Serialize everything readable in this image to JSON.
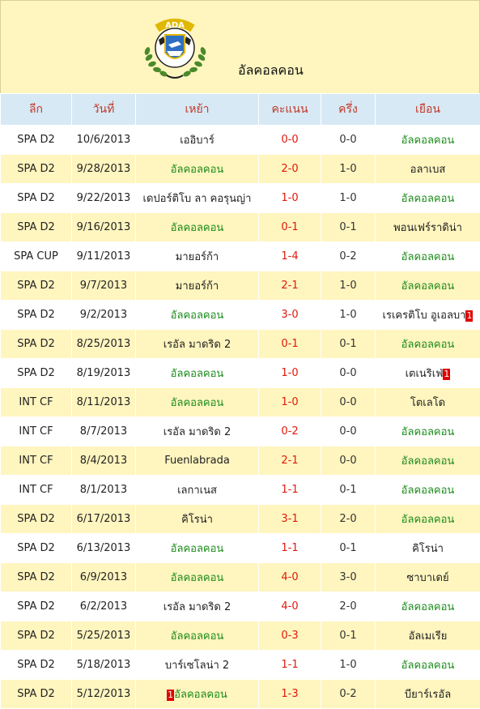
{
  "header": {
    "team_name": "อัลคอลคอน",
    "logo_text": "ADA"
  },
  "columns": {
    "league": "ลีก",
    "date": "วันที่",
    "home": "เหย้า",
    "score": "คะแนน",
    "half": "ครึ่ง",
    "away": "เยือน"
  },
  "rows": [
    {
      "league": "SPA D2",
      "date": "10/6/2013",
      "home": "เออิบาร์",
      "score": "0-0",
      "half": "0-0",
      "away": "อัลคอลคอน",
      "hl": "away"
    },
    {
      "league": "SPA D2",
      "date": "9/28/2013",
      "home": "อัลคอลคอน",
      "score": "2-0",
      "half": "1-0",
      "away": "อลาเบส",
      "hl": "home"
    },
    {
      "league": "SPA D2",
      "date": "9/22/2013",
      "home": "เดปอร์ติโบ ลา คอรุนญ่า",
      "score": "1-0",
      "half": "1-0",
      "away": "อัลคอลคอน",
      "hl": "away"
    },
    {
      "league": "SPA D2",
      "date": "9/16/2013",
      "home": "อัลคอลคอน",
      "score": "0-1",
      "half": "0-1",
      "away": "พอนเฟร์ราดิน่า",
      "hl": "home"
    },
    {
      "league": "SPA CUP",
      "date": "9/11/2013",
      "home": "มายอร์ก้า",
      "score": "1-4",
      "half": "0-2",
      "away": "อัลคอลคอน",
      "hl": "away"
    },
    {
      "league": "SPA D2",
      "date": "9/7/2013",
      "home": "มายอร์ก้า",
      "score": "2-1",
      "half": "1-0",
      "away": "อัลคอลคอน",
      "hl": "away"
    },
    {
      "league": "SPA D2",
      "date": "9/2/2013",
      "home": "อัลคอลคอน",
      "score": "3-0",
      "half": "1-0",
      "away": "เรเครติโบ อูเอลบา",
      "away_card": "1",
      "hl": "home"
    },
    {
      "league": "SPA D2",
      "date": "8/25/2013",
      "home": "เรอัล มาดริด 2",
      "score": "0-1",
      "half": "0-1",
      "away": "อัลคอลคอน",
      "hl": "away"
    },
    {
      "league": "SPA D2",
      "date": "8/19/2013",
      "home": "อัลคอลคอน",
      "score": "1-0",
      "half": "0-0",
      "away": "เตเนริเฟ่",
      "away_card": "1",
      "hl": "home"
    },
    {
      "league": "INT CF",
      "date": "8/11/2013",
      "home": "อัลคอลคอน",
      "score": "1-0",
      "half": "0-0",
      "away": "โตเลโด",
      "hl": "home"
    },
    {
      "league": "INT CF",
      "date": "8/7/2013",
      "home": "เรอัล มาดริด 2",
      "score": "0-2",
      "half": "0-0",
      "away": "อัลคอลคอน",
      "hl": "away"
    },
    {
      "league": "INT CF",
      "date": "8/4/2013",
      "home": "Fuenlabrada",
      "score": "2-1",
      "half": "0-0",
      "away": "อัลคอลคอน",
      "hl": "away"
    },
    {
      "league": "INT CF",
      "date": "8/1/2013",
      "home": "เลกาเนส",
      "score": "1-1",
      "half": "0-1",
      "away": "อัลคอลคอน",
      "hl": "away"
    },
    {
      "league": "SPA D2",
      "date": "6/17/2013",
      "home": "คิโรน่า",
      "score": "3-1",
      "half": "2-0",
      "away": "อัลคอลคอน",
      "hl": "away"
    },
    {
      "league": "SPA D2",
      "date": "6/13/2013",
      "home": "อัลคอลคอน",
      "score": "1-1",
      "half": "0-1",
      "away": "คิโรน่า",
      "hl": "home"
    },
    {
      "league": "SPA D2",
      "date": "6/9/2013",
      "home": "อัลคอลคอน",
      "score": "4-0",
      "half": "3-0",
      "away": "ซาบาเดย์",
      "hl": "home"
    },
    {
      "league": "SPA D2",
      "date": "6/2/2013",
      "home": "เรอัล มาดริด 2",
      "score": "4-0",
      "half": "2-0",
      "away": "อัลคอลคอน",
      "hl": "away"
    },
    {
      "league": "SPA D2",
      "date": "5/25/2013",
      "home": "อัลคอลคอน",
      "score": "0-3",
      "half": "0-1",
      "away": "อัลเมเรีย",
      "hl": "home"
    },
    {
      "league": "SPA D2",
      "date": "5/18/2013",
      "home": "บาร์เซโลน่า 2",
      "score": "1-1",
      "half": "1-0",
      "away": "อัลคอลคอน",
      "hl": "away"
    },
    {
      "league": "SPA D2",
      "date": "5/12/2013",
      "home": "อัลคอลคอน",
      "home_card": "1",
      "score": "1-3",
      "half": "0-2",
      "away": "บียาร์เรอัล",
      "hl": "home"
    }
  ]
}
